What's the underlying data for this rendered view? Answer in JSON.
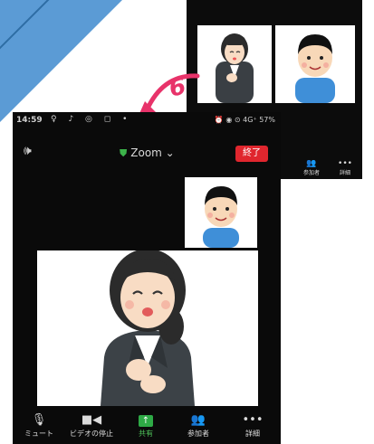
{
  "step_number": "6",
  "previous_screen": {
    "controls": [
      {
        "label": "参加者",
        "icon": "participants-icon"
      },
      {
        "label": "詳細",
        "icon": "more-icon"
      }
    ]
  },
  "status_bar": {
    "time": "14:59",
    "left_icons": "♀ ♪ ◎ ◻ •",
    "right_info": "⏰ ◉ ⊙ 4G⁺ 57%"
  },
  "topbar": {
    "app_name": "Zoom",
    "end_label": "終了"
  },
  "controls": [
    {
      "key": "mute",
      "label": "ミュート",
      "icon": "microphone-icon"
    },
    {
      "key": "video",
      "label": "ビデオの停止",
      "icon": "video-camera-icon"
    },
    {
      "key": "share",
      "label": "共有",
      "icon": "share-icon"
    },
    {
      "key": "participants",
      "label": "参加者",
      "icon": "participants-icon"
    },
    {
      "key": "more",
      "label": "詳細",
      "icon": "more-icon"
    }
  ],
  "colors": {
    "end_button": "#e0262e",
    "share_green": "#2eaa46",
    "secure_shield": "#3cb34a",
    "arrow_pink": "#e8336a",
    "corner_blue": "#5b9bd5"
  }
}
